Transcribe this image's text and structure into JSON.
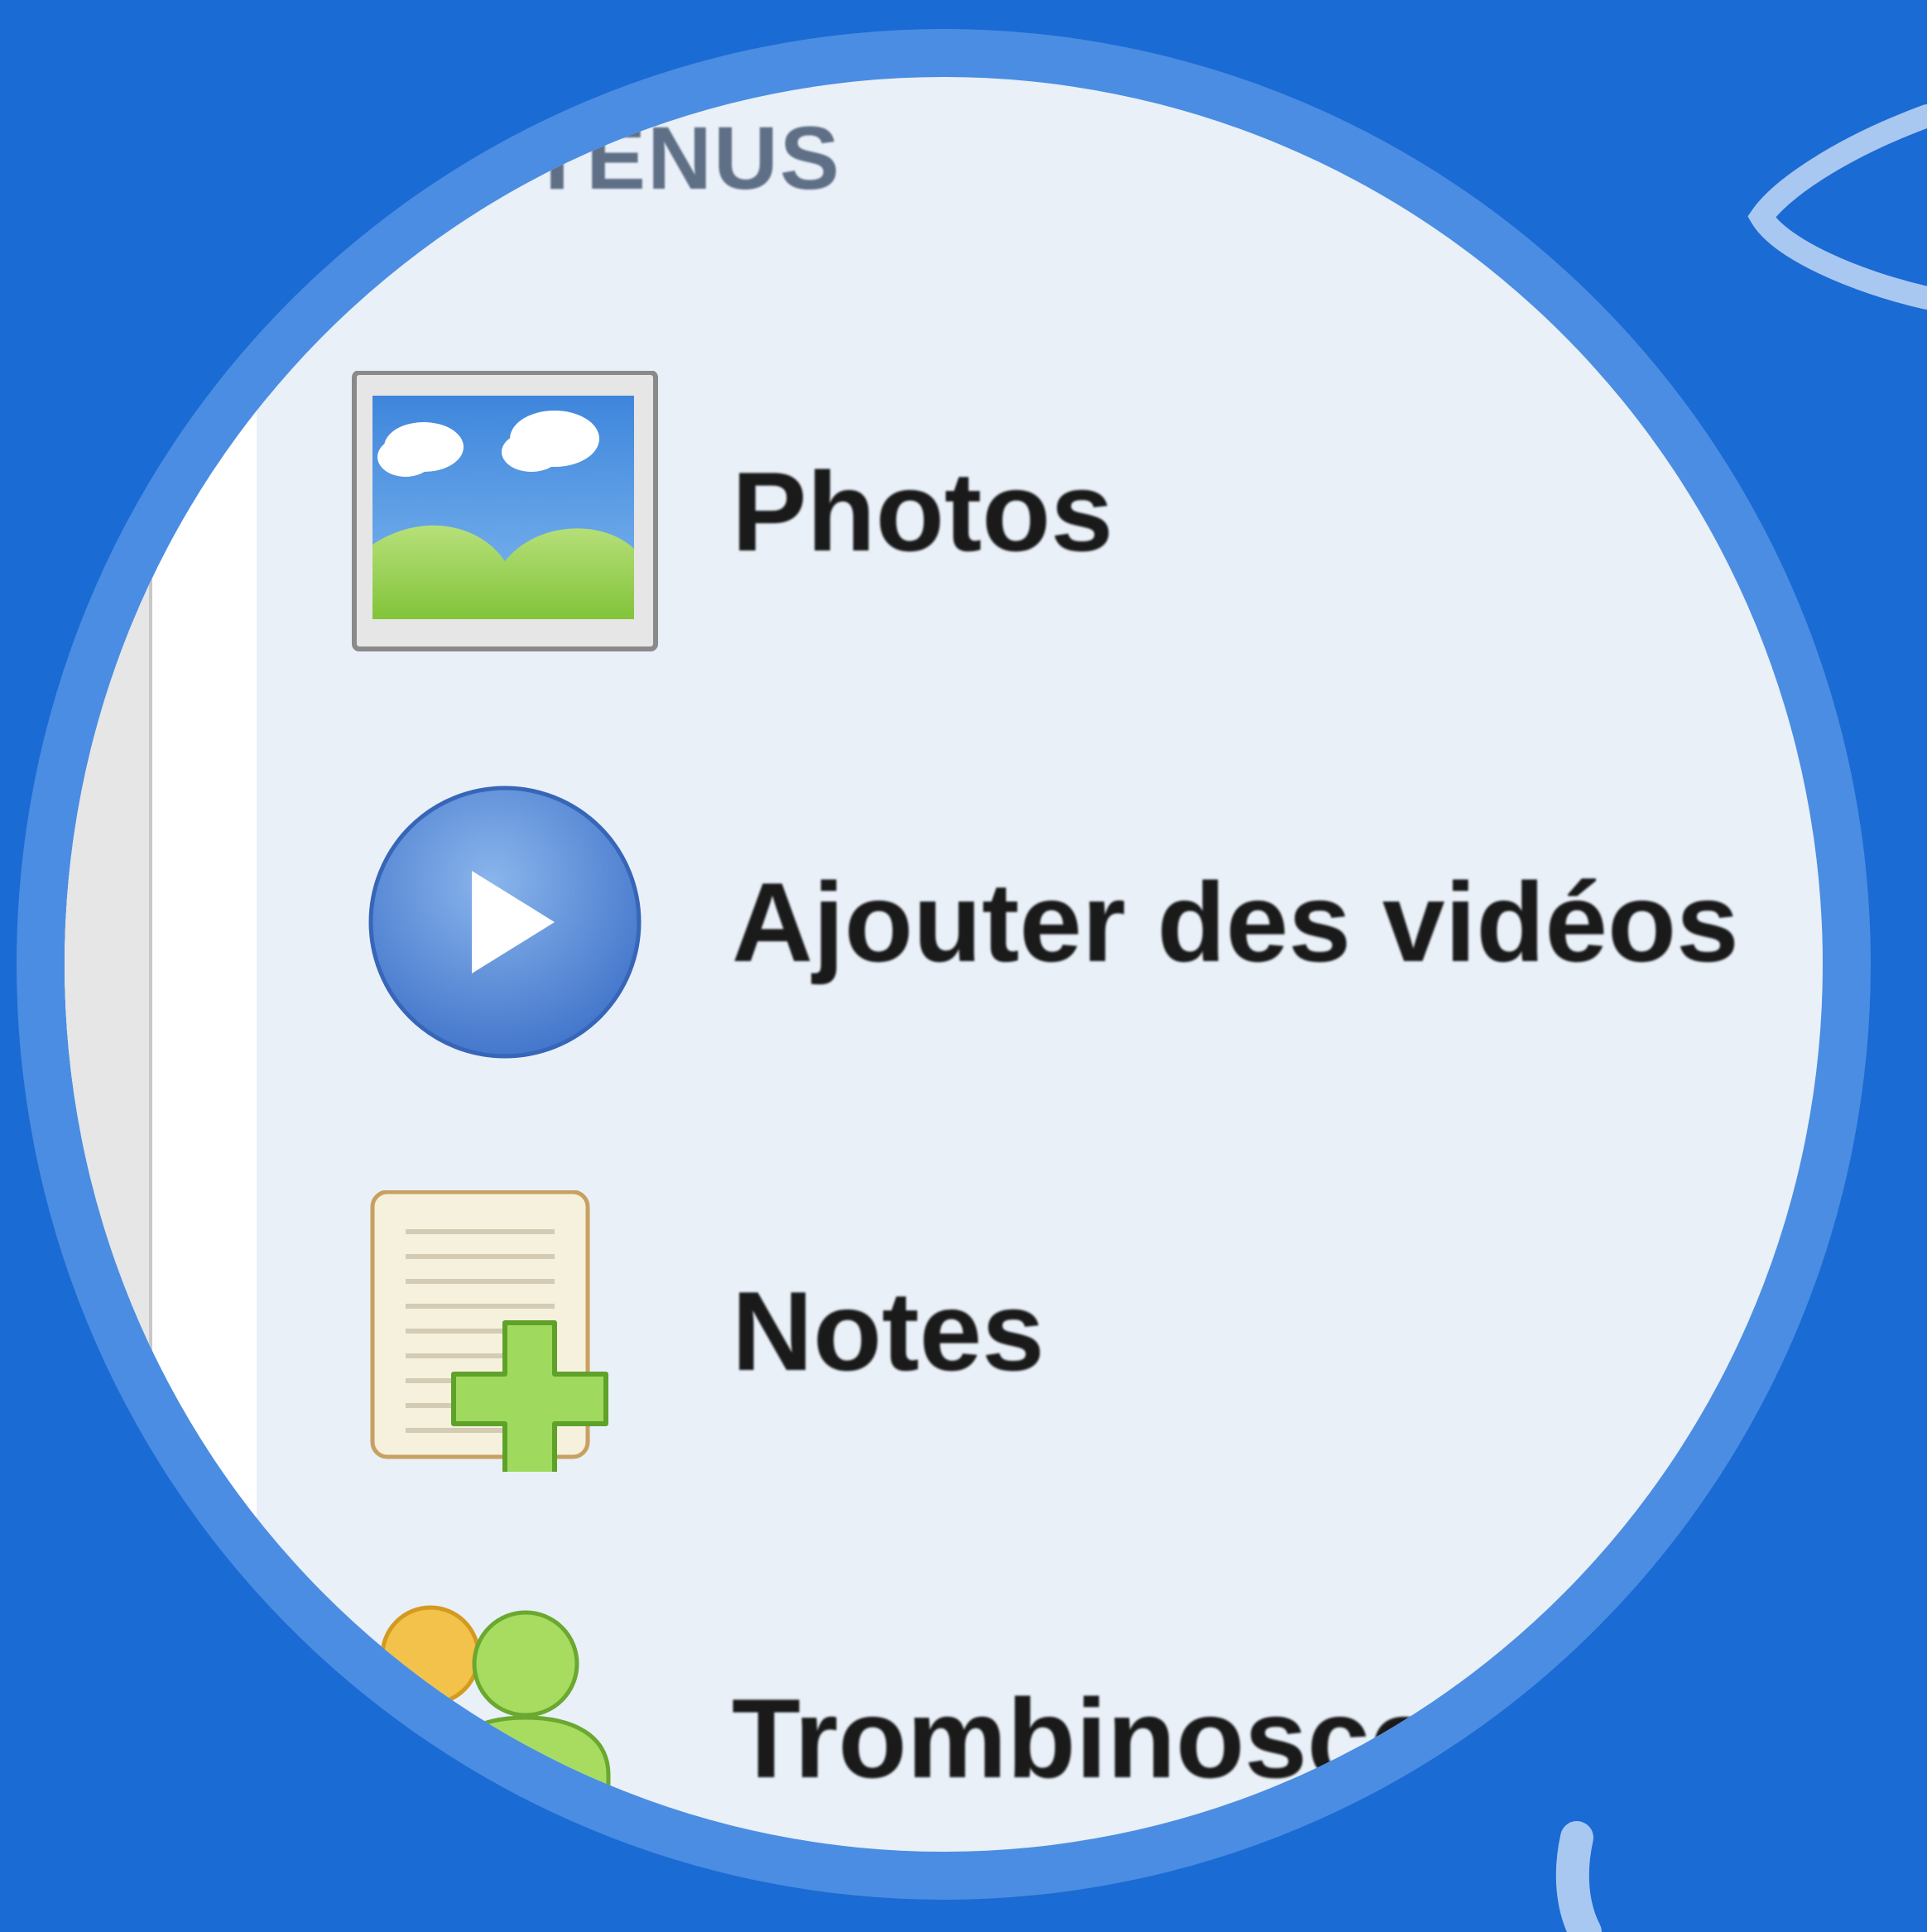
{
  "colors": {
    "background": "#1a6bd4",
    "ring": "#4b8de2",
    "lens": "#e9f0f8",
    "section_title": "#5f6f86",
    "label": "#1a1a1a"
  },
  "sidebar": {
    "section_title": "TENUS",
    "items": [
      {
        "label": "Photos",
        "icon": "photo-icon"
      },
      {
        "label": "Ajouter des vidéos",
        "icon": "play-video-icon"
      },
      {
        "label": "Notes",
        "icon": "add-note-icon"
      },
      {
        "label": "Trombinoscop",
        "icon": "people-icon"
      }
    ]
  }
}
